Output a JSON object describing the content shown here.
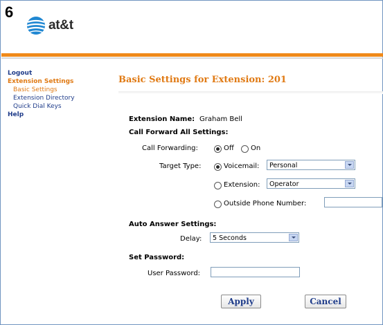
{
  "badge": "6",
  "brand": {
    "name": "at&t",
    "globe_color": "#1f87d2"
  },
  "sidebar": {
    "logout": "Logout",
    "extension_settings": "Extension Settings",
    "basic_settings": "Basic Settings",
    "extension_directory": "Extension Directory",
    "quick_dial_keys": "Quick Dial Keys",
    "help": "Help"
  },
  "main": {
    "title": "Basic Settings for Extension: 201",
    "extension_name_label": "Extension Name:",
    "extension_name_value": "Graham Bell",
    "call_forward_heading": "Call Forward All Settings:",
    "call_forwarding_label": "Call Forwarding:",
    "off_label": "Off",
    "on_label": "On",
    "target_type_label": "Target Type:",
    "voicemail_label": "Voicemail:",
    "voicemail_value": "Personal",
    "extension_label": "Extension:",
    "extension_value": "Operator",
    "outside_label": "Outside Phone Number:",
    "outside_value": "",
    "auto_answer_heading": "Auto Answer Settings:",
    "delay_label": "Delay:",
    "delay_value": "5 Seconds",
    "set_password_heading": "Set Password:",
    "user_password_label": "User Password:",
    "user_password_value": "",
    "apply_label": "Apply",
    "cancel_label": "Cancel"
  },
  "colors": {
    "accent": "#e07a14",
    "link": "#1f3c8a",
    "bar": "#f08a1a"
  }
}
